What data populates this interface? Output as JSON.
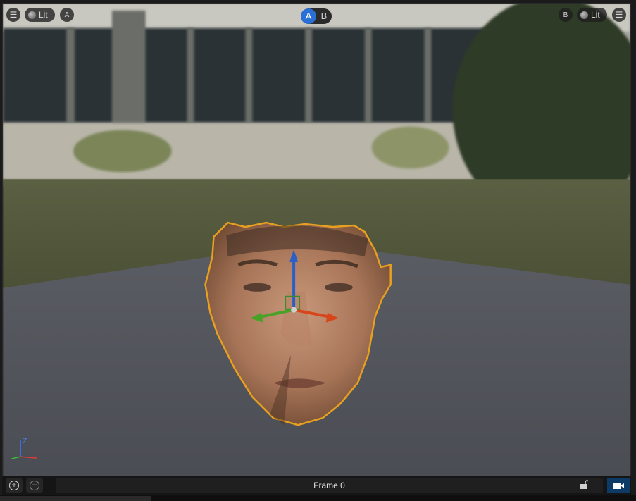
{
  "viewport": {
    "left_toolbar": {
      "menu_icon": "menu-icon",
      "lit_label": "Lit",
      "a_label": "A"
    },
    "center_toggle": {
      "a": "A",
      "b": "B",
      "active": "A"
    },
    "right_toolbar": {
      "b_label": "B",
      "lit_label": "Lit",
      "menu_icon": "menu-icon"
    },
    "axis_labels": {
      "z": "Z"
    }
  },
  "statusbar": {
    "add_label": "+",
    "remove_label": "−",
    "frame_label": "Frame 0",
    "lock_icon": "unlock-icon",
    "camera_icon": "camera-icon"
  },
  "colors": {
    "selection_outline": "#e8a020",
    "gizmo_x": "#d8451a",
    "gizmo_y": "#4aa128",
    "gizmo_z": "#2a5fc8",
    "active_toggle": "#2a6fd6"
  }
}
